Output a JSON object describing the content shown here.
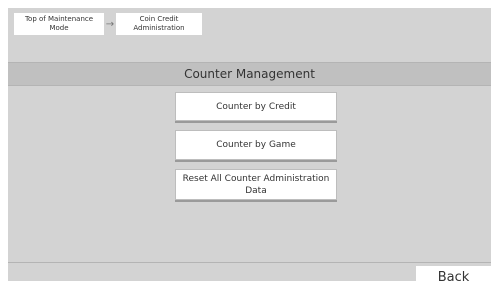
{
  "breadcrumb": {
    "items": [
      {
        "label": "Top of Maintenance\nMode"
      },
      {
        "label": "Coin Credit\nAdministration"
      }
    ],
    "separator": "→"
  },
  "page": {
    "title": "Counter Management"
  },
  "menu": {
    "buttons": [
      {
        "label": "Counter by Credit"
      },
      {
        "label": "Counter by Game"
      },
      {
        "label": "Reset All Counter Administration\nData"
      }
    ]
  },
  "footer": {
    "back_label": "Back"
  },
  "colors": {
    "panel_background": "#d3d3d3",
    "title_bar": "#c0c0c0",
    "button_face": "#ffffff",
    "text": "#333333"
  }
}
